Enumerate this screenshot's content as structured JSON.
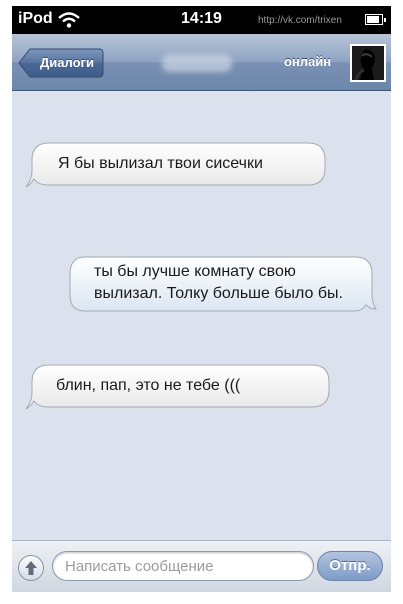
{
  "status_bar": {
    "carrier": "iPod",
    "time": "14:19",
    "watermark": "http://vk.com/trixen"
  },
  "nav_bar": {
    "back_label": "Диалоги",
    "contact_status": "онлайн"
  },
  "messages": [
    {
      "direction": "incoming",
      "text": "Я бы вылизал твои сисечки"
    },
    {
      "direction": "outgoing",
      "lines": [
        "ты бы лучше комнату свою",
        "вылизал. Толку больше было бы."
      ]
    },
    {
      "direction": "incoming",
      "text": "блин, пап, это не тебе ((("
    }
  ],
  "compose": {
    "placeholder": "Написать сообщение",
    "send_label": "Отпр."
  }
}
